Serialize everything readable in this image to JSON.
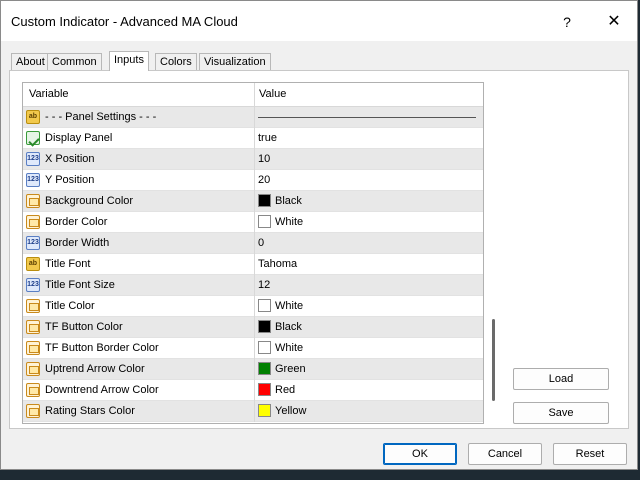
{
  "window": {
    "title": "Custom Indicator - Advanced MA Cloud",
    "help_label": "?",
    "close_label": "✕"
  },
  "tabs": [
    "About",
    "Common",
    "Inputs",
    "Colors",
    "Visualization"
  ],
  "active_tab": "Inputs",
  "grid": {
    "headers": {
      "variable": "Variable",
      "value": "Value"
    },
    "rows": [
      {
        "icon": "ab",
        "variable": "- - - Panel Settings - - -",
        "value": ""
      },
      {
        "icon": "bool",
        "variable": "Display Panel",
        "value": "true"
      },
      {
        "icon": "num",
        "variable": "X Position",
        "value": "10"
      },
      {
        "icon": "num",
        "variable": "Y Position",
        "value": "20"
      },
      {
        "icon": "color",
        "variable": "Background Color",
        "value": "Black",
        "color": "#000000"
      },
      {
        "icon": "color",
        "variable": "Border Color",
        "value": "White",
        "color": "#ffffff"
      },
      {
        "icon": "num",
        "variable": "Border Width",
        "value": "0"
      },
      {
        "icon": "ab",
        "variable": "Title Font",
        "value": "Tahoma"
      },
      {
        "icon": "num",
        "variable": "Title Font Size",
        "value": "12"
      },
      {
        "icon": "color",
        "variable": "Title Color",
        "value": "White",
        "color": "#ffffff"
      },
      {
        "icon": "color",
        "variable": "TF Button Color",
        "value": "Black",
        "color": "#000000"
      },
      {
        "icon": "color",
        "variable": "TF Button Border Color",
        "value": "White",
        "color": "#ffffff"
      },
      {
        "icon": "color",
        "variable": "Uptrend Arrow Color",
        "value": "Green",
        "color": "#008000"
      },
      {
        "icon": "color",
        "variable": "Downtrend Arrow Color",
        "value": "Red",
        "color": "#ff0000"
      },
      {
        "icon": "color",
        "variable": "Rating Stars Color",
        "value": "Yellow",
        "color": "#ffff00"
      }
    ]
  },
  "side_buttons": {
    "load": "Load",
    "save": "Save"
  },
  "bottom_buttons": {
    "ok": "OK",
    "cancel": "Cancel",
    "reset": "Reset"
  }
}
